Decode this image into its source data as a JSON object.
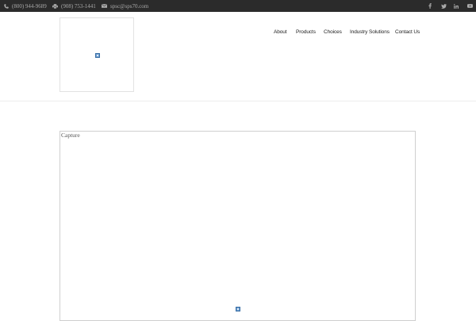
{
  "topbar": {
    "phone": "(800) 944-9689",
    "fax": "(908) 753-1441",
    "email": "spsc@sps70.com",
    "social": [
      {
        "icon": "facebook-icon",
        "glyph": "f"
      },
      {
        "icon": "twitter-icon",
        "glyph": "t"
      },
      {
        "icon": "linkedin-icon",
        "glyph": "in"
      },
      {
        "icon": "youtube-icon",
        "glyph": "▶"
      }
    ]
  },
  "header": {
    "logo_icon": "broken-image-icon"
  },
  "nav": {
    "items": [
      {
        "label": "About"
      },
      {
        "label": "Products"
      },
      {
        "label": "Choices"
      },
      {
        "label": "Industry Solutions"
      },
      {
        "label": "Contact Us"
      }
    ]
  },
  "content": {
    "caption": "Capture",
    "image_icon": "broken-image-icon"
  },
  "colors": {
    "topbar_bg": "#2b2b2b",
    "topbar_text": "#a9a9a9",
    "nav_text": "#222222"
  }
}
